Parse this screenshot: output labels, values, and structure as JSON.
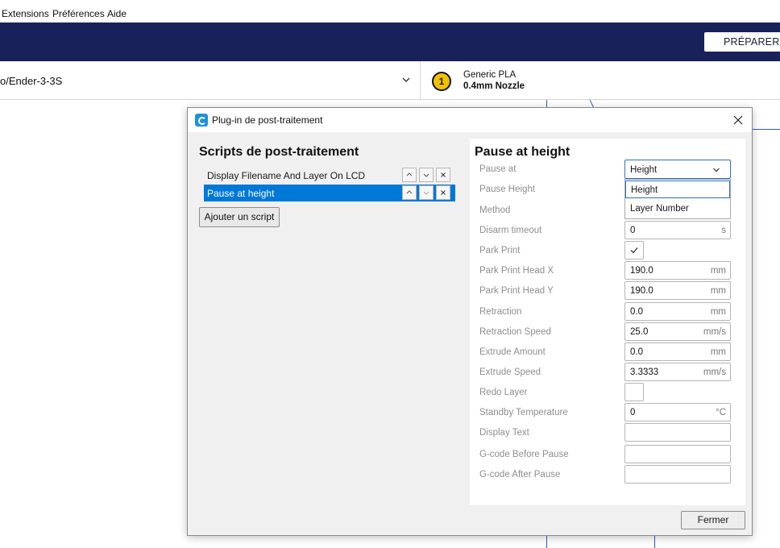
{
  "menubar": {
    "items": [
      {
        "label": "Extensions"
      },
      {
        "label": "Préférences"
      },
      {
        "label": "Aide"
      }
    ]
  },
  "topbar": {
    "stage_button": "PRÉPARER",
    "background_color": "#19215a"
  },
  "printer": {
    "name": "o/Ender-3-3S",
    "extruder_number": "1",
    "material": "Generic PLA",
    "nozzle": "0.4mm Nozzle",
    "extruder_color": "#f2c200"
  },
  "dialog": {
    "title": "Plug-in de post-traitement",
    "icon": "cura-logo-icon",
    "scripts_heading": "Scripts de post-traitement",
    "scripts": [
      {
        "label": "Display Filename And Layer On LCD",
        "selected": false
      },
      {
        "label": "Pause at height",
        "selected": true
      }
    ],
    "script_buttons": {
      "up": "^",
      "down": "v",
      "remove": "×"
    },
    "add_script_label": "Ajouter un script",
    "close_label": "Fermer",
    "selection_color": "#0078d7"
  },
  "settings": {
    "heading": "Pause at height",
    "pause_at": {
      "label": "Pause at",
      "value": "Height",
      "options": [
        "Height",
        "Layer Number"
      ]
    },
    "pause_height": {
      "label": "Pause Height"
    },
    "method": {
      "label": "Method"
    },
    "disarm_timeout": {
      "label": "Disarm timeout",
      "value": "0",
      "unit": "s"
    },
    "park_print": {
      "label": "Park Print",
      "checked": true
    },
    "park_x": {
      "label": "Park Print Head X",
      "value": "190.0",
      "unit": "mm"
    },
    "park_y": {
      "label": "Park Print Head Y",
      "value": "190.0",
      "unit": "mm"
    },
    "retraction": {
      "label": "Retraction",
      "value": "0.0",
      "unit": "mm"
    },
    "retraction_speed": {
      "label": "Retraction Speed",
      "value": "25.0",
      "unit": "mm/s"
    },
    "extrude_amount": {
      "label": "Extrude Amount",
      "value": "0.0",
      "unit": "mm"
    },
    "extrude_speed": {
      "label": "Extrude Speed",
      "value": "3.3333",
      "unit": "mm/s"
    },
    "redo_layer": {
      "label": "Redo Layer",
      "checked": false
    },
    "standby_temperature": {
      "label": "Standby Temperature",
      "value": "0",
      "unit": "°C"
    },
    "display_text": {
      "label": "Display Text",
      "value": ""
    },
    "gcode_before": {
      "label": "G-code Before Pause",
      "value": ""
    },
    "gcode_after": {
      "label": "G-code After Pause",
      "value": ""
    }
  }
}
